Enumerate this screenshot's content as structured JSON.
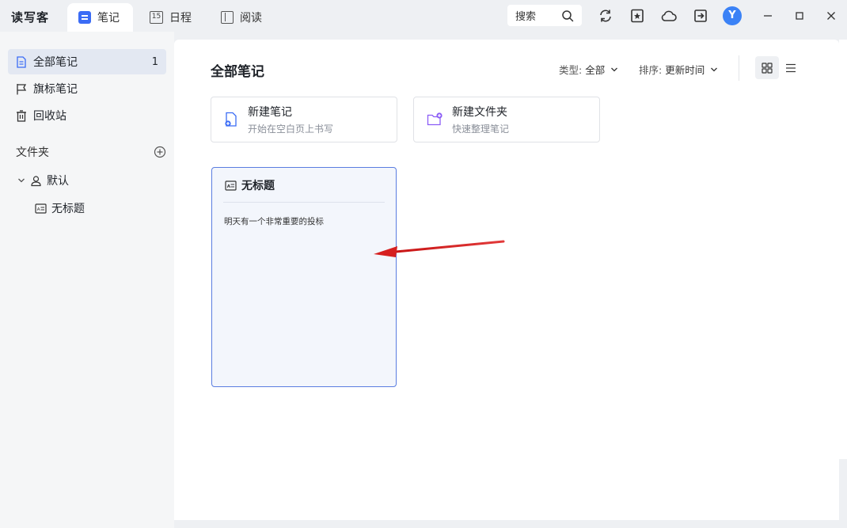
{
  "app": {
    "name": "读写客"
  },
  "tabs": [
    {
      "label": "笔记",
      "icon": "notes-icon",
      "active": true
    },
    {
      "label": "日程",
      "icon": "calendar-icon",
      "icon_text": "15",
      "active": false
    },
    {
      "label": "阅读",
      "icon": "book-icon",
      "active": false
    }
  ],
  "toolbar": {
    "search_label": "搜索",
    "user_initial": "Y",
    "icons": [
      "sync-icon",
      "star-doc-icon",
      "cloud-icon",
      "export-icon"
    ]
  },
  "sidebar": {
    "items": [
      {
        "label": "全部笔记",
        "count": "1",
        "icon": "document-icon",
        "active": true
      },
      {
        "label": "旗标笔记",
        "icon": "flag-icon"
      },
      {
        "label": "回收站",
        "icon": "trash-icon"
      }
    ],
    "folder_header": "文件夹",
    "tree": {
      "folder": {
        "label": "默认",
        "icon": "folder-user-icon",
        "expanded": true
      },
      "notes": [
        {
          "label": "无标题",
          "icon": "note-card-icon"
        }
      ]
    }
  },
  "main": {
    "title": "全部笔记",
    "filter_type": {
      "label": "类型:",
      "value": "全部"
    },
    "filter_sort": {
      "label": "排序:",
      "value": "更新时间"
    },
    "view_modes": [
      {
        "name": "grid",
        "active": true
      },
      {
        "name": "list",
        "active": false
      }
    ],
    "actions": [
      {
        "title": "新建笔记",
        "subtitle": "开始在空白页上书写",
        "icon": "new-note-icon"
      },
      {
        "title": "新建文件夹",
        "subtitle": "快速整理笔记",
        "icon": "new-folder-icon"
      }
    ],
    "notes": [
      {
        "title": "无标题",
        "excerpt": "明天有一个非常重要的投标"
      }
    ]
  },
  "colors": {
    "accent": "#3b6cf5",
    "card_border": "#5a7de0",
    "card_bg": "#f3f6fc",
    "annotation_arrow": "#d61f1f",
    "folder_icon_accent": "#8b5cf6"
  }
}
